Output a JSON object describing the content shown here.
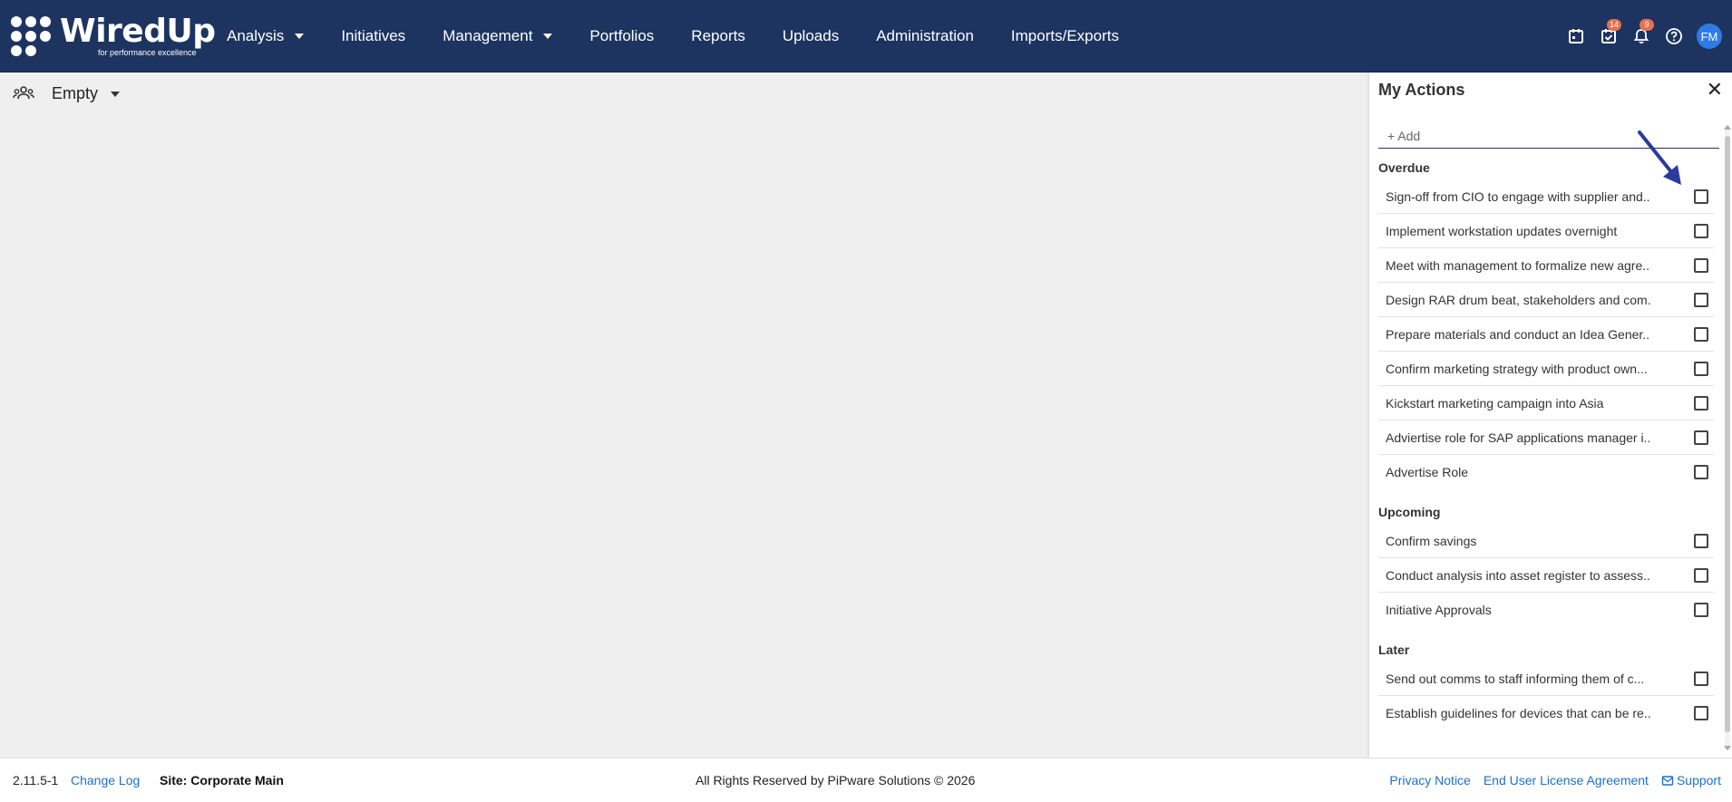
{
  "app": {
    "logo_text": "WiredUp",
    "logo_tagline": "for performance excellence"
  },
  "nav": {
    "items": [
      {
        "label": "Analysis",
        "has_dropdown": true
      },
      {
        "label": "Initiatives",
        "has_dropdown": false
      },
      {
        "label": "Management",
        "has_dropdown": true
      },
      {
        "label": "Portfolios",
        "has_dropdown": false
      },
      {
        "label": "Reports",
        "has_dropdown": false
      },
      {
        "label": "Uploads",
        "has_dropdown": false
      },
      {
        "label": "Administration",
        "has_dropdown": false
      },
      {
        "label": "Imports/Exports",
        "has_dropdown": false
      }
    ]
  },
  "top_icons": {
    "calendar_icon": "calendar-icon",
    "tasks_icon": "tasks-icon",
    "tasks_badge": "14",
    "notifications_icon": "bell-icon",
    "notifications_badge": "9",
    "help_icon": "help-icon",
    "avatar_initials": "FM"
  },
  "selector": {
    "icon": "team-icon",
    "label": "Empty"
  },
  "panel": {
    "title": "My Actions",
    "close_label": "✕",
    "add_placeholder": "+ Add",
    "sections": [
      {
        "title": "Overdue",
        "items": [
          "Sign-off from CIO to engage with supplier and...",
          "Implement workstation updates overnight",
          "Meet with management to formalize new agre...",
          "Design RAR drum beat, stakeholders and com...",
          "Prepare materials and conduct an Idea Gener...",
          "Confirm marketing strategy with product own...",
          "Kickstart marketing campaign into Asia",
          "Adviertise role for SAP applications manager i...",
          "Advertise Role"
        ]
      },
      {
        "title": "Upcoming",
        "items": [
          "Confirm savings",
          "Conduct analysis into asset register to assess...",
          "Initiative Approvals"
        ]
      },
      {
        "title": "Later",
        "items": [
          "Send out comms to staff informing them of c...",
          "Establish guidelines for devices that can be re..."
        ]
      }
    ]
  },
  "footer": {
    "version": "2.11.5-1",
    "change_log": "Change Log",
    "site": "Site: Corporate Main",
    "rights": "All Rights Reserved by PiPware Solutions © 2026",
    "privacy": "Privacy Notice",
    "eula": "End User License Agreement",
    "support": "Support"
  },
  "colors": {
    "nav_bg": "#1d3461",
    "accent": "#1e6fd0",
    "badge": "#e8704f",
    "avatar": "#2f7be5",
    "annotation_arrow": "#2b3a9c"
  }
}
